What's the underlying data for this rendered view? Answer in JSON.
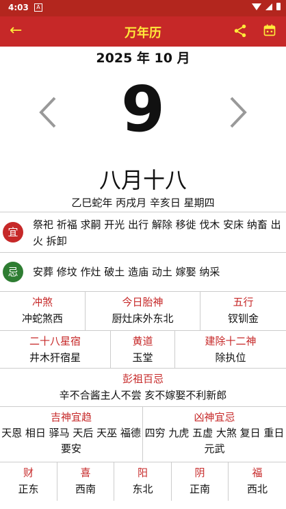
{
  "status": {
    "time": "4:03",
    "notif": "A"
  },
  "appbar": {
    "title": "万年历",
    "back": "←"
  },
  "header": {
    "year_month": "2025 年 10 月",
    "day": "9",
    "lunar": "八月十八",
    "ganzhi": "乙巳蛇年 丙戌月 辛亥日 星期四"
  },
  "yi": {
    "badge": "宜",
    "text": "祭祀 祈福 求嗣 开光 出行 解除 移徙 伐木 安床 纳畜 出火 拆卸"
  },
  "ji": {
    "badge": "忌",
    "text": "安葬 修坟 作灶 破土 造庙 动土 嫁娶 纳采"
  },
  "row1": [
    {
      "label": "冲煞",
      "value": "冲蛇煞西"
    },
    {
      "label": "今日胎神",
      "value": "厨灶床外东北"
    },
    {
      "label": "五行",
      "value": "钗钏金"
    }
  ],
  "row2": [
    {
      "label": "二十八星宿",
      "value": "井木犴宿星"
    },
    {
      "label": "黄道",
      "value": "玉堂"
    },
    {
      "label": "建除十二神",
      "value": "除执位"
    }
  ],
  "pengzu": {
    "label": "彭祖百忌",
    "value": "辛不合酱主人不尝 亥不嫁娶不利新郎"
  },
  "shen": [
    {
      "label": "吉神宜趋",
      "value": "天恩 相日 驿马 天后 天巫 福德 要安"
    },
    {
      "label": "凶神宜忌",
      "value": "四穷 九虎 五虚 大煞 复日 重日 元武"
    }
  ],
  "directions": [
    {
      "label": "财",
      "value": "正东"
    },
    {
      "label": "喜",
      "value": "西南"
    },
    {
      "label": "阳",
      "value": "东北"
    },
    {
      "label": "阴",
      "value": "正南"
    },
    {
      "label": "福",
      "value": "西北"
    }
  ],
  "colors": {
    "appbar": "#c62828",
    "title": "#ffeb3b",
    "label_red": "#c62828",
    "yi_badge": "#c62828",
    "ji_badge": "#2e7d32"
  }
}
